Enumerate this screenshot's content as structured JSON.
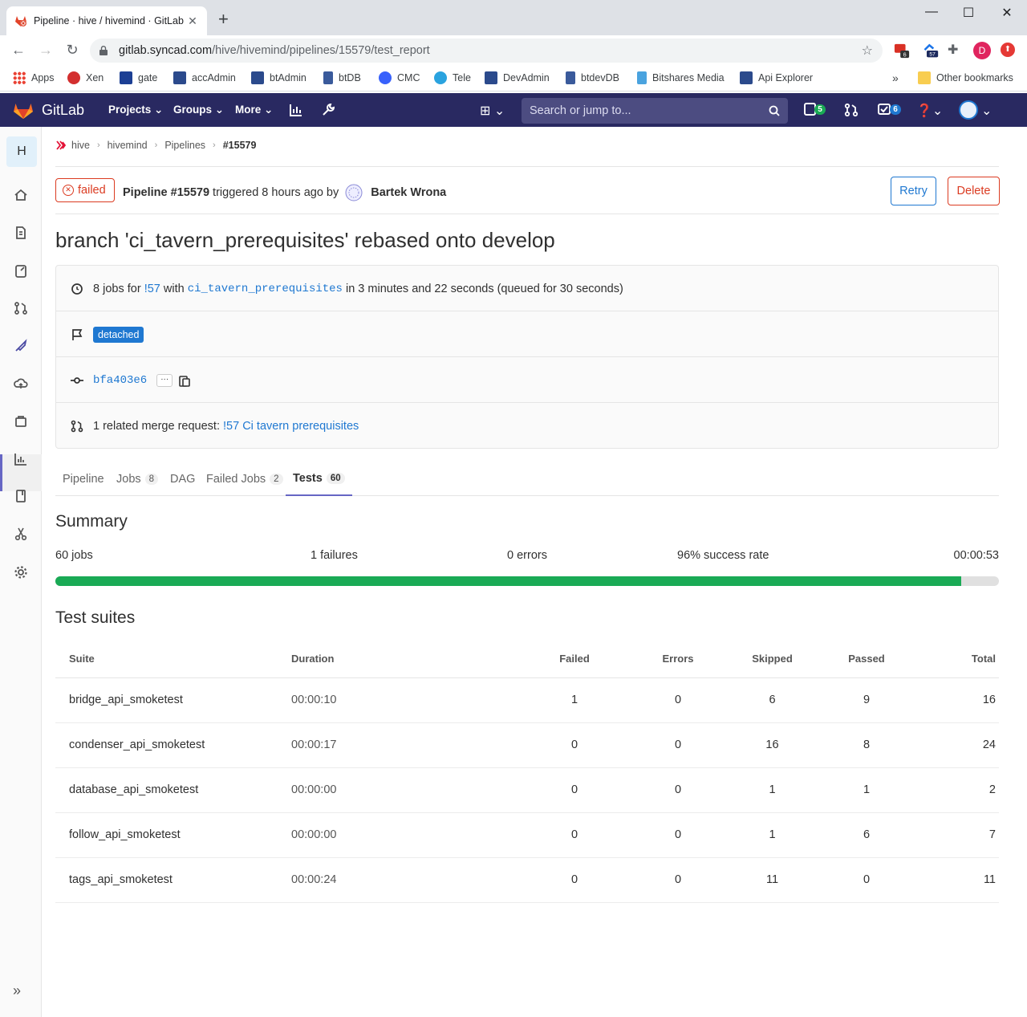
{
  "browser": {
    "tab_title": "Pipeline · hive / hivemind · GitLab",
    "url_host": "gitlab.syncad.com",
    "url_path": "/hive/hivemind/pipelines/15579/test_report",
    "extensions": [
      {
        "name": "ext-red",
        "badge": "6"
      },
      {
        "name": "ext-blue",
        "badge": "57"
      },
      {
        "name": "puzzle",
        "badge": ""
      },
      {
        "name": "profile",
        "badge": "D"
      }
    ],
    "bookmarks": [
      "Apps",
      "Xen",
      "gate",
      "accAdmin",
      "btAdmin",
      "btDB",
      "CMC",
      "Tele",
      "DevAdmin",
      "btdevDB",
      "Bitshares Media",
      "Api Explorer"
    ],
    "bookmarks_more": "»",
    "other_bookmarks": "Other bookmarks"
  },
  "gitlab": {
    "brand": "GitLab",
    "nav": [
      "Projects",
      "Groups",
      "More"
    ],
    "search_placeholder": "Search or jump to...",
    "issues_count": "5",
    "todos_count": "6"
  },
  "sidebar": {
    "project_letter": "H",
    "items": [
      "project-overview",
      "repository",
      "issues",
      "merge-requests",
      "ci-cd",
      "operations",
      "packages",
      "analytics",
      "wiki",
      "snippets",
      "settings"
    ],
    "collapse": "»"
  },
  "breadcrumb": [
    "hive",
    "hivemind",
    "Pipelines",
    "#15579"
  ],
  "pipeline": {
    "status": "failed",
    "label": "Pipeline #15579",
    "triggered": "triggered 8 hours ago by",
    "user": "Bartek Wrona",
    "retry": "Retry",
    "delete": "Delete",
    "title": "branch 'ci_tavern_prerequisites' rebased onto develop",
    "jobs_text": "8 jobs for",
    "mr_ref": "!57",
    "with": "with",
    "branch": "ci_tavern_prerequisites",
    "duration_text": "in 3 minutes and 22 seconds (queued for 30 seconds)",
    "tag": "detached",
    "commit": "bfa403e6",
    "ellipsis": "···",
    "related_prefix": "1 related merge request:",
    "related_link": "!57 Ci tavern prerequisites"
  },
  "tabs": [
    {
      "label": "Pipeline",
      "count": ""
    },
    {
      "label": "Jobs",
      "count": "8"
    },
    {
      "label": "DAG",
      "count": ""
    },
    {
      "label": "Failed Jobs",
      "count": "2"
    },
    {
      "label": "Tests",
      "count": "60"
    }
  ],
  "summary": {
    "heading": "Summary",
    "jobs": "60 jobs",
    "failures": "1 failures",
    "errors": "0 errors",
    "success_rate": "96% success rate",
    "duration": "00:00:53",
    "success_fraction": 0.96
  },
  "suites": {
    "heading": "Test suites",
    "columns": [
      "Suite",
      "Duration",
      "Failed",
      "Errors",
      "Skipped",
      "Passed",
      "Total"
    ],
    "rows": [
      [
        "bridge_api_smoketest",
        "00:00:10",
        "1",
        "0",
        "6",
        "9",
        "16"
      ],
      [
        "condenser_api_smoketest",
        "00:00:17",
        "0",
        "0",
        "16",
        "8",
        "24"
      ],
      [
        "database_api_smoketest",
        "00:00:00",
        "0",
        "0",
        "1",
        "1",
        "2"
      ],
      [
        "follow_api_smoketest",
        "00:00:00",
        "0",
        "0",
        "1",
        "6",
        "7"
      ],
      [
        "tags_api_smoketest",
        "00:00:24",
        "0",
        "0",
        "11",
        "0",
        "11"
      ]
    ]
  },
  "colors": {
    "header": "#292961",
    "failed": "#db3b21",
    "link": "#1f78d1",
    "success": "#1aaa55",
    "active_tab": "#6666c4"
  }
}
